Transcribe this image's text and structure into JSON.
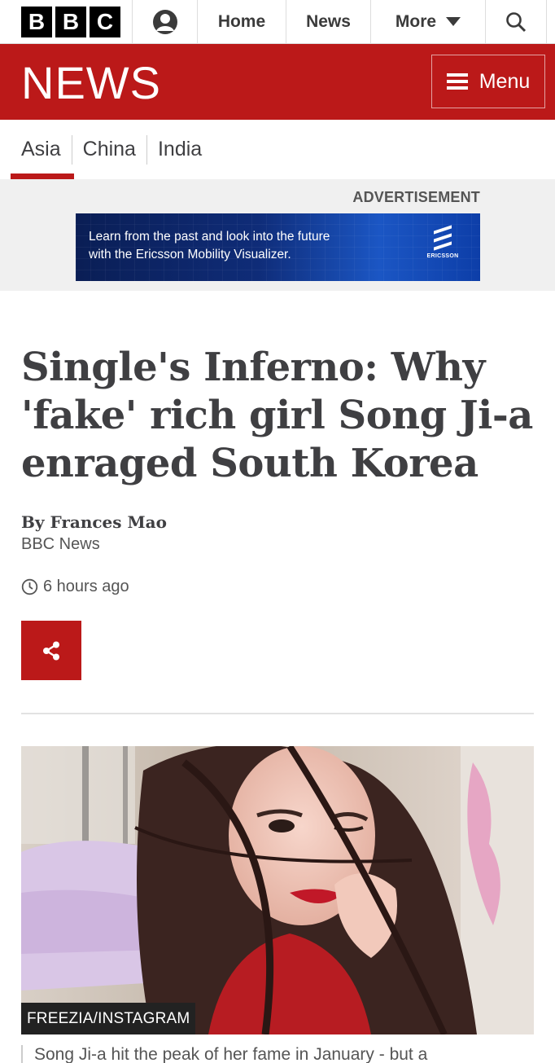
{
  "top_nav": {
    "logo_letters": [
      "B",
      "B",
      "C"
    ],
    "home": "Home",
    "news": "News",
    "more": "More"
  },
  "news_header": {
    "title": "NEWS",
    "menu_label": "Menu",
    "brand_color": "#bb1919"
  },
  "sub_nav": {
    "items": [
      "Asia",
      "China",
      "India"
    ],
    "active": "Asia"
  },
  "advertisement": {
    "label": "ADVERTISEMENT",
    "line1": "Learn from the past and look into the future",
    "line2": "with the Ericsson Mobility Visualizer.",
    "brand": "ERICSSON"
  },
  "article": {
    "headline": "Single's Inferno: Why 'fake' rich girl Song Ji-a enraged South Korea",
    "author": "By Frances Mao",
    "organisation": "BBC News",
    "published": "6 hours ago",
    "image_credit": "FREEZIA/INSTAGRAM",
    "caption": "Song Ji-a hit the peak of her fame in January - but a"
  }
}
